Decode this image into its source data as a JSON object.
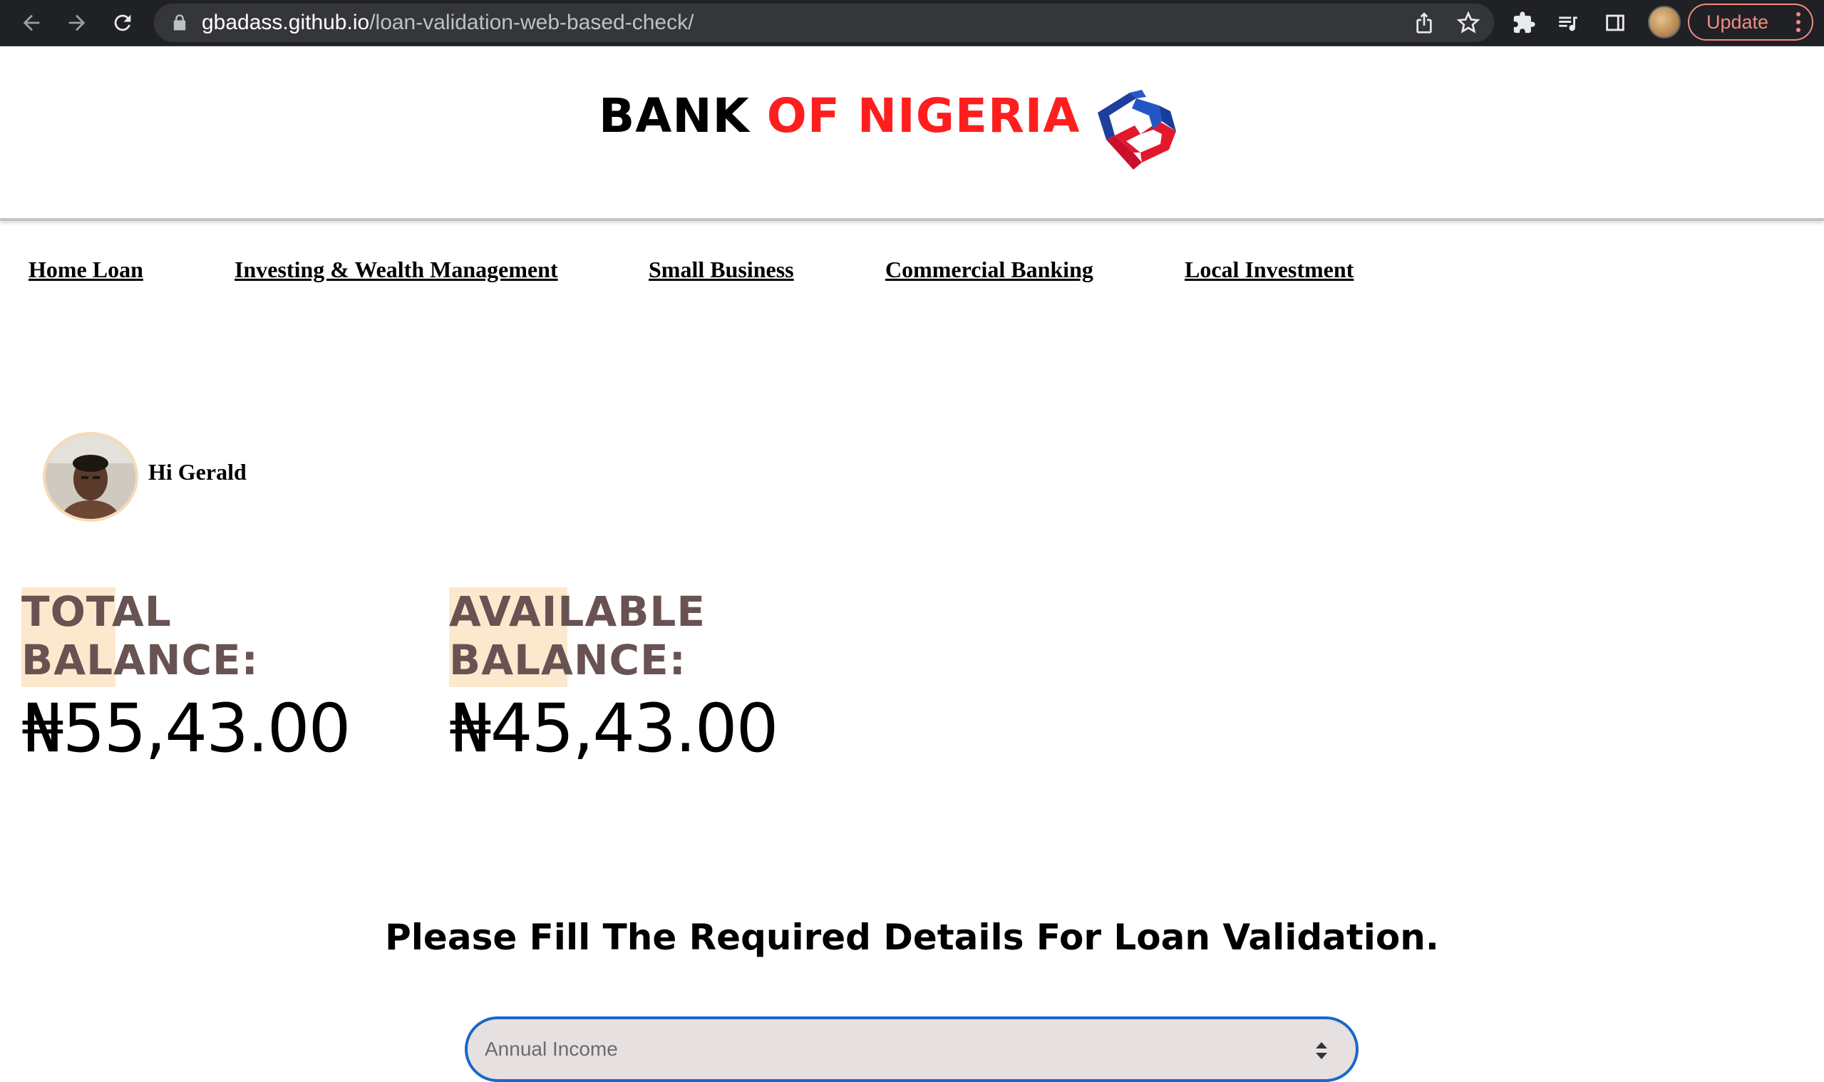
{
  "browser": {
    "url_host": "gbadass.github.io",
    "url_path": "/loan-validation-web-based-check/",
    "update_label": "Update",
    "icons": {
      "back": "arrow-left-icon",
      "forward": "arrow-right-icon",
      "reload": "reload-icon",
      "lock": "lock-icon",
      "share": "share-icon",
      "bookmark": "star-icon",
      "extensions": "puzzle-icon",
      "reading_list": "reading-list-icon",
      "side_panel": "side-panel-icon",
      "menu": "vertical-dots-icon"
    }
  },
  "header": {
    "brand_part1": "BANK ",
    "brand_part2": "OF NIGERIA",
    "brand_colors": {
      "primary": "#000000",
      "accent": "#ff1e1e"
    },
    "logo_icon": "bank-logo-icon"
  },
  "nav": {
    "items": [
      {
        "label": "Home Loan"
      },
      {
        "label": "Investing & Wealth Management"
      },
      {
        "label": "Small Business"
      },
      {
        "label": "Commercial Banking"
      },
      {
        "label": "Local Investment"
      }
    ]
  },
  "user": {
    "greeting": "Hi Gerald"
  },
  "balances": {
    "total_label_line1": "TOTAL",
    "total_label_line2": "BALANCE:",
    "total_amount": "₦55,43.00",
    "available_label_line1": "AVAILABLE",
    "available_label_line2": "BALANCE:",
    "available_amount": "₦45,43.00",
    "label_color": "#695252",
    "highlight_color": "#fce8cd"
  },
  "form": {
    "title": "Please Fill The Required Details For Loan Validation.",
    "annual_income_placeholder": "Annual Income",
    "focus_color": "#1a67c9"
  }
}
